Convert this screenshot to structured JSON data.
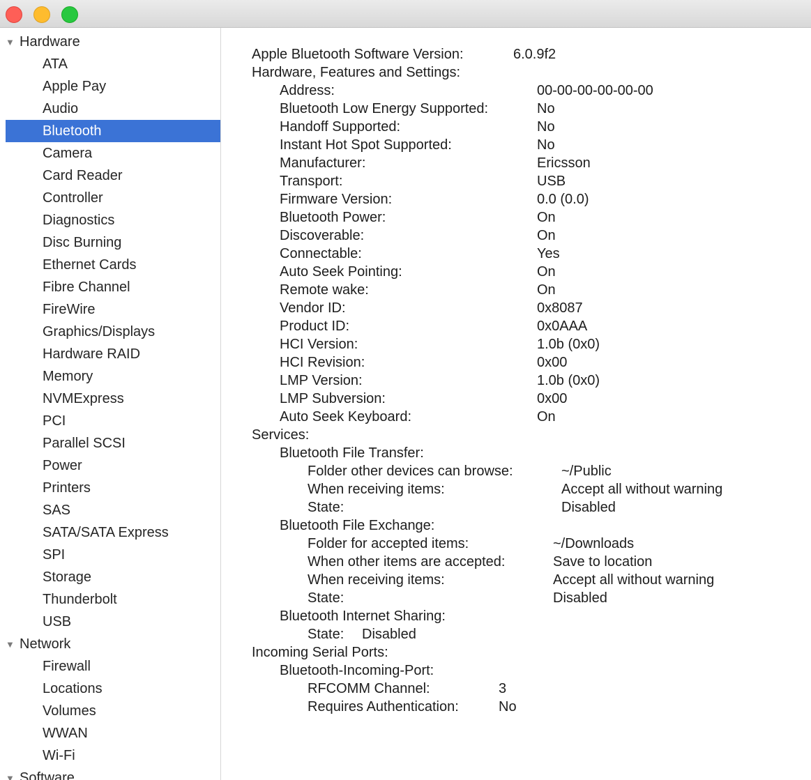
{
  "window": {
    "buttons": [
      "close",
      "minimize",
      "zoom"
    ]
  },
  "sidebar": {
    "groups": [
      {
        "label": "Hardware",
        "items": [
          "ATA",
          "Apple Pay",
          "Audio",
          "Bluetooth",
          "Camera",
          "Card Reader",
          "Controller",
          "Diagnostics",
          "Disc Burning",
          "Ethernet Cards",
          "Fibre Channel",
          "FireWire",
          "Graphics/Displays",
          "Hardware RAID",
          "Memory",
          "NVMExpress",
          "PCI",
          "Parallel SCSI",
          "Power",
          "Printers",
          "SAS",
          "SATA/SATA Express",
          "SPI",
          "Storage",
          "Thunderbolt",
          "USB"
        ]
      },
      {
        "label": "Network",
        "items": [
          "Firewall",
          "Locations",
          "Volumes",
          "WWAN",
          "Wi-Fi"
        ]
      },
      {
        "label": "Software",
        "items": []
      }
    ],
    "selected": "Bluetooth",
    "colors": {
      "selection_bg": "#3b73d6",
      "selection_text": "#ffffff"
    }
  },
  "detail": {
    "lines": [
      {
        "key": "Apple Bluetooth Software Version:",
        "value": "6.0.9f2"
      },
      {
        "key": "Hardware, Features and Settings:",
        "value": ""
      },
      {
        "key": "Address:",
        "value": "00-00-00-00-00-00"
      },
      {
        "key": "Bluetooth Low Energy Supported:",
        "value": "No"
      },
      {
        "key": "Handoff Supported:",
        "value": "No"
      },
      {
        "key": "Instant Hot Spot Supported:",
        "value": "No"
      },
      {
        "key": "Manufacturer:",
        "value": "Ericsson"
      },
      {
        "key": "Transport:",
        "value": "USB"
      },
      {
        "key": "Firmware Version:",
        "value": "0.0 (0.0)"
      },
      {
        "key": "Bluetooth Power:",
        "value": "On"
      },
      {
        "key": "Discoverable:",
        "value": "On"
      },
      {
        "key": "Connectable:",
        "value": "Yes"
      },
      {
        "key": "Auto Seek Pointing:",
        "value": "On"
      },
      {
        "key": "Remote wake:",
        "value": "On"
      },
      {
        "key": "Vendor ID:",
        "value": "0x8087"
      },
      {
        "key": "Product ID:",
        "value": "0x0AAA"
      },
      {
        "key": "HCI Version:",
        "value": "1.0b (0x0)"
      },
      {
        "key": "HCI Revision:",
        "value": "0x00"
      },
      {
        "key": "LMP Version:",
        "value": "1.0b (0x0)"
      },
      {
        "key": "LMP Subversion:",
        "value": "0x00"
      },
      {
        "key": "Auto Seek Keyboard:",
        "value": "On"
      },
      {
        "key": "Services:",
        "value": ""
      },
      {
        "key": "Bluetooth File Transfer:",
        "value": ""
      },
      {
        "key": "Folder other devices can browse:",
        "value": "~/Public"
      },
      {
        "key": "When receiving items:",
        "value": "Accept all without warning"
      },
      {
        "key": "State:",
        "value": "Disabled"
      },
      {
        "key": "Bluetooth File Exchange:",
        "value": ""
      },
      {
        "key": "Folder for accepted items:",
        "value": "~/Downloads"
      },
      {
        "key": "When other items are accepted:",
        "value": "Save to location"
      },
      {
        "key": "When receiving items:",
        "value": "Accept all without warning"
      },
      {
        "key": "State:",
        "value": "Disabled"
      },
      {
        "key": "Bluetooth Internet Sharing:",
        "value": ""
      },
      {
        "key": "State:",
        "value": "Disabled"
      },
      {
        "key": "Incoming Serial Ports:",
        "value": ""
      },
      {
        "key": "Bluetooth-Incoming-Port:",
        "value": ""
      },
      {
        "key": "RFCOMM Channel:",
        "value": "3"
      },
      {
        "key": "Requires Authentication:",
        "value": "No"
      }
    ]
  }
}
